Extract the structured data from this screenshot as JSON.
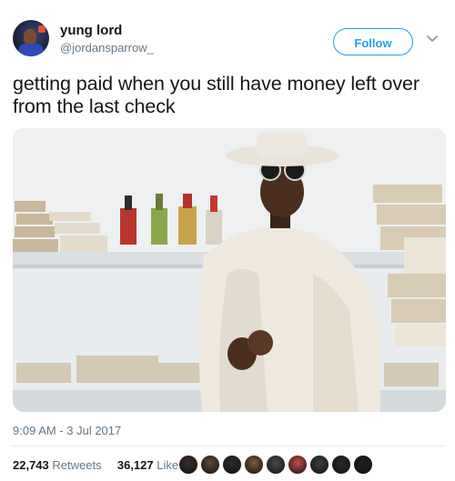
{
  "user": {
    "display_name": "yung lord",
    "handle": "@jordansparrow_"
  },
  "follow_button": {
    "label": "Follow"
  },
  "tweet": {
    "text": "getting paid when you still have money left over from the last check",
    "timestamp": "9:09 AM - 3 Jul 2017"
  },
  "stats": {
    "retweets_count": "22,743",
    "retweets_label": "Retweets",
    "likes_count": "36,127",
    "likes_label": "Likes"
  },
  "icons": {
    "chevron": "chevron-down-icon"
  },
  "colors": {
    "accent": "#1da1f2",
    "text": "#14171a",
    "muted": "#657786",
    "divider": "#e6ecf0"
  },
  "liked_by_avatars": [
    {
      "color": "#3a2f2a"
    },
    {
      "color": "#5b4a3c"
    },
    {
      "color": "#2b2b2b"
    },
    {
      "color": "#7a5a3a"
    },
    {
      "color": "#4a4a4a"
    },
    {
      "color": "#c94a4a"
    },
    {
      "color": "#3d3d3d"
    },
    {
      "color": "#2a2a2a"
    },
    {
      "color": "#1f1f1f"
    }
  ]
}
